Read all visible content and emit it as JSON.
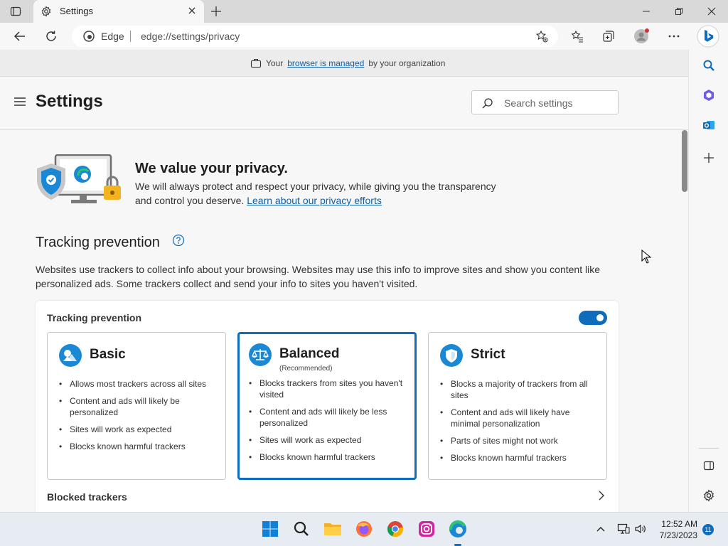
{
  "window": {
    "tab_title": "Settings"
  },
  "address_bar": {
    "label": "Edge",
    "url": "edge://settings/privacy"
  },
  "banner": {
    "prefix": "Your",
    "link": "browser is managed",
    "suffix": "by your organization"
  },
  "header": {
    "title": "Settings",
    "search_placeholder": "Search settings"
  },
  "hero": {
    "title": "We value your privacy.",
    "text": "We will always protect and respect your privacy, while giving you the transparency and control you deserve.",
    "link": "Learn about our privacy efforts"
  },
  "tracking": {
    "title": "Tracking prevention",
    "description": "Websites use trackers to collect info about your browsing. Websites may use this info to improve sites and show you content like personalized ads. Some trackers collect and send your info to sites you haven't visited.",
    "card_label": "Tracking prevention",
    "enabled": true,
    "options": [
      {
        "name": "Basic",
        "subtitle": "",
        "selected": false,
        "bullets": [
          "Allows most trackers across all sites",
          "Content and ads will likely be personalized",
          "Sites will work as expected",
          "Blocks known harmful trackers"
        ]
      },
      {
        "name": "Balanced",
        "subtitle": "(Recommended)",
        "selected": true,
        "bullets": [
          "Blocks trackers from sites you haven't visited",
          "Content and ads will likely be less personalized",
          "Sites will work as expected",
          "Blocks known harmful trackers"
        ]
      },
      {
        "name": "Strict",
        "subtitle": "",
        "selected": false,
        "bullets": [
          "Blocks a majority of trackers from all sites",
          "Content and ads will likely have minimal personalization",
          "Parts of sites might not work",
          "Blocks known harmful trackers"
        ]
      }
    ],
    "blocked_trackers": "Blocked trackers"
  },
  "taskbar": {
    "time": "12:52 AM",
    "date": "7/23/2023",
    "notification_count": "11"
  },
  "colors": {
    "accent": "#0f6cbd",
    "link": "#0f5fa6",
    "background": "#f7f7f7"
  }
}
